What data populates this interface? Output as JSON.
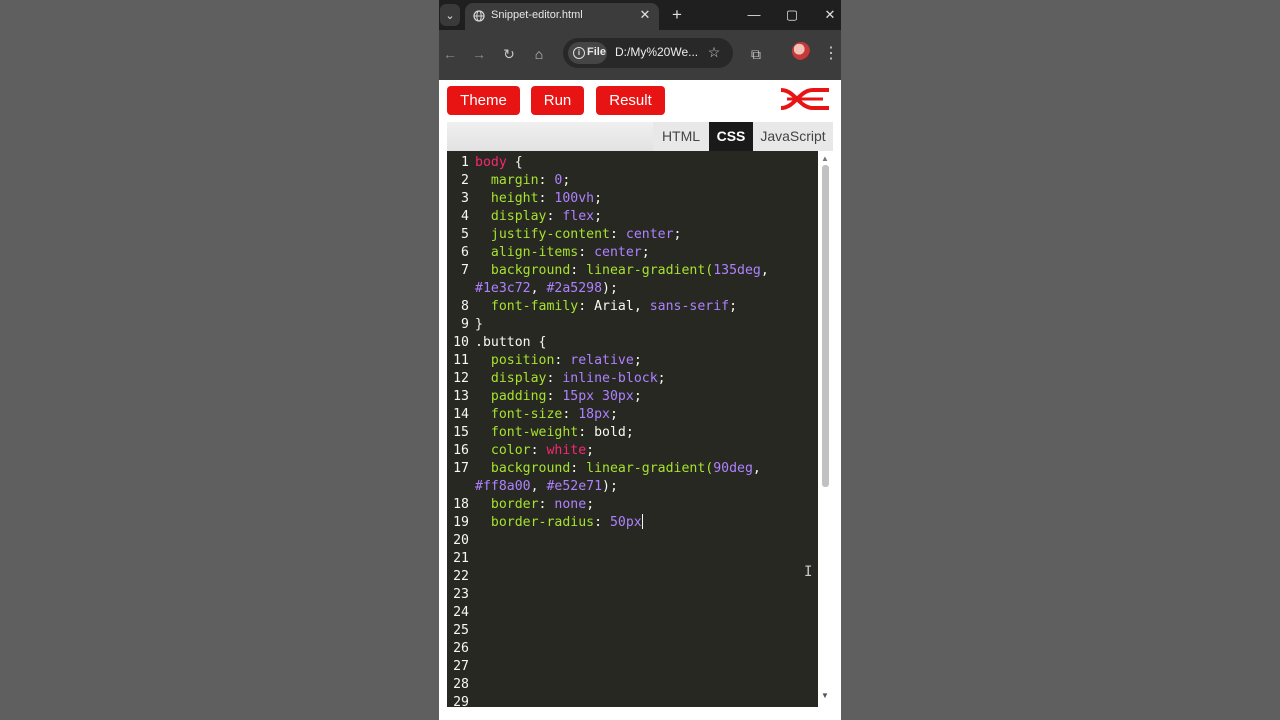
{
  "browser": {
    "tab_title": "Snippet-editor.html",
    "chip_label": "File",
    "url": "D:/My%20We...",
    "icons": [
      "tab-search-icon",
      "globe-icon",
      "close-icon",
      "new-tab-icon",
      "minimize-icon",
      "maximize-icon",
      "window-close-icon",
      "back-icon",
      "forward-icon",
      "reload-icon",
      "home-icon",
      "info-icon",
      "star-icon",
      "extensions-icon",
      "profile-avatar",
      "menu-icon"
    ]
  },
  "app": {
    "buttons": {
      "theme": "Theme",
      "run": "Run",
      "result": "Result"
    },
    "tabs": {
      "html": "HTML",
      "css": "CSS",
      "js": "JavaScript"
    },
    "active_tab": "CSS",
    "accent_color": "#e81414"
  },
  "editor": {
    "line_numbers": [
      "1",
      "2",
      "3",
      "4",
      "5",
      "6",
      "7",
      "8",
      "9",
      "10",
      "11",
      "12",
      "13",
      "14",
      "15",
      "16",
      "17",
      "18",
      "19",
      "20",
      "21",
      "22",
      "23",
      "24",
      "25",
      "26",
      "27",
      "28",
      "29"
    ],
    "code": {
      "l1_sel": "body",
      "l1_brace": " {",
      "l2_prop": "  margin",
      "l2_val": "0",
      "l3_prop": "  height",
      "l3_val": "100vh",
      "l4_prop": "  display",
      "l4_val": "flex",
      "l5_prop": "  justify-content",
      "l5_val": "center",
      "l6_prop": "  align-items",
      "l6_val": "center",
      "l7_prop": "  background",
      "l7_fn": "linear-gradient(",
      "l7_val": "135deg",
      "l7b_c1": "#1e3c72",
      "l7b_c2": "#2a5298",
      "l8_prop": "  font-family",
      "l8_a": "Arial",
      "l8_b": "sans-serif",
      "l9": "}",
      "l10": ".button {",
      "l11_prop": "  position",
      "l11_val": "relative",
      "l12_prop": "  display",
      "l12_val": "inline-block",
      "l13_prop": "  padding",
      "l13_val": "15px 30px",
      "l14_prop": "  font-size",
      "l14_val": "18px",
      "l15_prop": "  font-weight",
      "l15_val": "bold",
      "l16_prop": "  color",
      "l16_val": "white",
      "l17_prop": "  background",
      "l17_fn": "linear-gradient(",
      "l17_val": "90deg",
      "l17b_c1": "#ff8a00",
      "l17b_c2": "#e52e71",
      "l18_prop": "  border",
      "l18_val": "none",
      "l19_prop": "  border-radius",
      "l19_val": "50px"
    }
  }
}
